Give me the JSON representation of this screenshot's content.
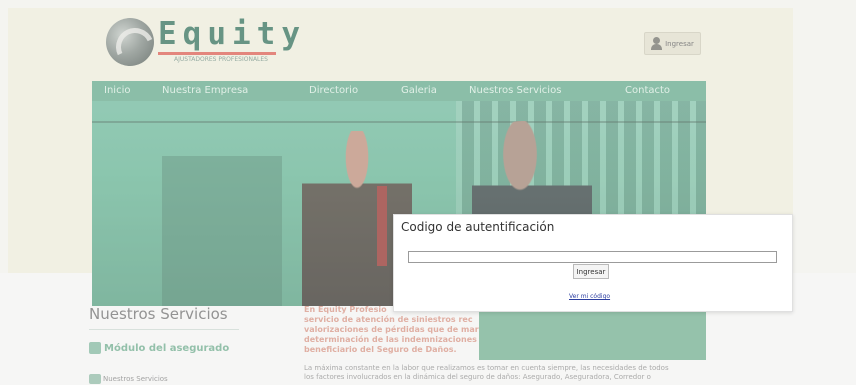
{
  "header": {
    "logo_name": "Equity",
    "logo_tagline": "AJUSTADORES PROFESIONALES",
    "login_label": "Ingresar"
  },
  "nav": {
    "items": [
      {
        "label": "Inicio"
      },
      {
        "label": "Nuestra Empresa"
      },
      {
        "label": "Directorio"
      },
      {
        "label": "Galeria"
      },
      {
        "label": "Nuestros Servicios"
      },
      {
        "label": "Contacto"
      }
    ]
  },
  "sidebar": {
    "title": "Nuestros Servicios",
    "module_link": "Módulo del asegurado",
    "services_link": "Nuestros Servicios"
  },
  "content": {
    "intro_lines": [
      "En Equity Profesio",
      "servicio de atención de siniestros rec",
      "valorizaciones de pérdidas que de mar",
      "determinación de las indemnizaciones",
      "beneficiario del Seguro de Daños."
    ],
    "body_lines": [
      "La máxima constante en la labor que realizamos es tomar en cuenta siempre, las necesidades de todos",
      "los factores involucrados en la dinámica del seguro de daños: Asegurado, Aseguradora, Corredor o"
    ]
  },
  "modal": {
    "title": "Codigo de autentificación",
    "input_value": "",
    "submit_label": "Ingresar",
    "link_label": "Ver mi código"
  },
  "colors": {
    "brand_green": "#5fa687",
    "logo_green": "#2d6b55",
    "accent_red": "#d9584b",
    "link_blue": "#2c3ea0"
  }
}
